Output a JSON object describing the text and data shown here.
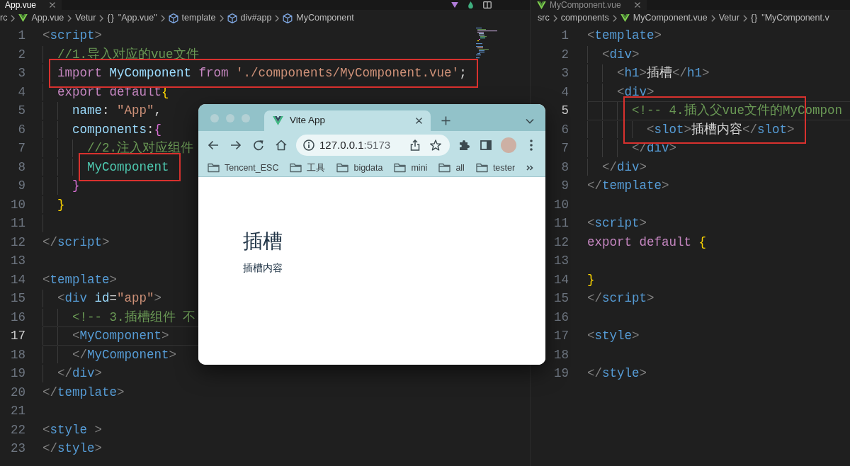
{
  "editor": {
    "panes": [
      {
        "focused": true,
        "toolbar_icons": true,
        "minimap": true,
        "tab": {
          "kind": "plain",
          "label": "App.vue"
        },
        "breadcrumbs": [
          {
            "kind": "text",
            "label": "rc"
          },
          {
            "kind": "vue",
            "label": "App.vue"
          },
          {
            "kind": "text",
            "label": "Vetur"
          },
          {
            "kind": "object",
            "symbol": "{}",
            "label": "\"App.vue\""
          },
          {
            "kind": "element",
            "label": "template"
          },
          {
            "kind": "element",
            "label": "div#app"
          },
          {
            "kind": "element",
            "label": "MyComponent"
          }
        ],
        "lines": [
          {
            "number": "1",
            "tokens": [
              {
                "kind": "punct",
                "text": "<"
              },
              {
                "kind": "tag",
                "text": "script"
              },
              {
                "kind": "punct",
                "text": ">"
              }
            ],
            "current": false,
            "framed": false,
            "children": [
              {
                "number": "2",
                "tokens": [
                  {
                    "kind": "comment",
                    "text": "//1.导入对应的vue文件"
                  }
                ],
                "current": false,
                "framed": false
              },
              {
                "number": "3",
                "tokens": [
                  {
                    "kind": "keyword",
                    "text": "import "
                  },
                  {
                    "kind": "name",
                    "text": "MyComponent "
                  },
                  {
                    "kind": "keyword",
                    "text": "from "
                  },
                  {
                    "kind": "string",
                    "text": "'./components/MyComponent.vue'"
                  },
                  {
                    "kind": "text",
                    "text": ";"
                  }
                ],
                "current": false,
                "framed": true
              },
              {
                "number": "4",
                "tokens": [
                  {
                    "kind": "keyword",
                    "text": "export default"
                  },
                  {
                    "kind": "brace",
                    "text": "{"
                  }
                ],
                "current": false,
                "framed": false,
                "children": [
                  {
                    "number": "5",
                    "tokens": [
                      {
                        "kind": "name",
                        "text": "name"
                      },
                      {
                        "kind": "text",
                        "text": ": "
                      },
                      {
                        "kind": "string",
                        "text": "\"App\""
                      },
                      {
                        "kind": "text",
                        "text": ","
                      }
                    ],
                    "current": false,
                    "framed": false
                  },
                  {
                    "number": "6",
                    "tokens": [
                      {
                        "kind": "name",
                        "text": "components"
                      },
                      {
                        "kind": "text",
                        "text": ":"
                      },
                      {
                        "kind": "brace2",
                        "text": "{"
                      }
                    ],
                    "current": false,
                    "framed": false,
                    "children": [
                      {
                        "number": "7",
                        "tokens": [
                          {
                            "kind": "comment",
                            "text": "//2.注入对应组件"
                          }
                        ],
                        "current": false,
                        "framed": false
                      },
                      {
                        "number": "8",
                        "tokens": [
                          {
                            "kind": "component",
                            "text": "MyComponent"
                          }
                        ],
                        "current": false,
                        "framed": true
                      }
                    ]
                  },
                  {
                    "number": "9",
                    "tokens": [
                      {
                        "kind": "brace2",
                        "text": "}"
                      }
                    ],
                    "current": false,
                    "framed": false
                  }
                ]
              },
              {
                "number": "10",
                "tokens": [
                  {
                    "kind": "brace",
                    "text": "}"
                  }
                ],
                "current": false,
                "framed": false
              },
              {
                "number": "11",
                "current": false,
                "framed": false
              }
            ]
          },
          {
            "number": "12",
            "tokens": [
              {
                "kind": "punct",
                "text": "</"
              },
              {
                "kind": "tag",
                "text": "script"
              },
              {
                "kind": "punct",
                "text": ">"
              }
            ],
            "current": false,
            "framed": false
          },
          {
            "number": "13",
            "current": false,
            "framed": false
          },
          {
            "number": "14",
            "tokens": [
              {
                "kind": "punct",
                "text": "<"
              },
              {
                "kind": "tag",
                "text": "template"
              },
              {
                "kind": "punct",
                "text": ">"
              }
            ],
            "current": false,
            "framed": false,
            "children": [
              {
                "number": "15",
                "tokens": [
                  {
                    "kind": "punct",
                    "text": "<"
                  },
                  {
                    "kind": "tag",
                    "text": "div "
                  },
                  {
                    "kind": "attr",
                    "text": "id"
                  },
                  {
                    "kind": "text",
                    "text": "="
                  },
                  {
                    "kind": "string",
                    "text": "\"app\""
                  },
                  {
                    "kind": "punct",
                    "text": ">"
                  }
                ],
                "current": false,
                "framed": false,
                "children": [
                  {
                    "number": "16",
                    "tokens": [
                      {
                        "kind": "comment",
                        "text": "<!-- 3.插槽组件 不"
                      }
                    ],
                    "current": false,
                    "framed": false
                  },
                  {
                    "number": "17",
                    "tokens": [
                      {
                        "kind": "punct",
                        "text": "<"
                      },
                      {
                        "kind": "tag",
                        "text": "MyComponent"
                      },
                      {
                        "kind": "punct",
                        "text": ">"
                      }
                    ],
                    "current": true,
                    "framed": false
                  },
                  {
                    "number": "18",
                    "tokens": [
                      {
                        "kind": "punct",
                        "text": "</"
                      },
                      {
                        "kind": "tag",
                        "text": "MyComponent"
                      },
                      {
                        "kind": "punct",
                        "text": ">"
                      }
                    ],
                    "current": false,
                    "framed": false
                  }
                ]
              },
              {
                "number": "19",
                "tokens": [
                  {
                    "kind": "punct",
                    "text": "</"
                  },
                  {
                    "kind": "tag",
                    "text": "div"
                  },
                  {
                    "kind": "punct",
                    "text": ">"
                  }
                ],
                "current": false,
                "framed": false
              }
            ]
          },
          {
            "number": "20",
            "tokens": [
              {
                "kind": "punct",
                "text": "</"
              },
              {
                "kind": "tag",
                "text": "template"
              },
              {
                "kind": "punct",
                "text": ">"
              }
            ],
            "current": false,
            "framed": false
          },
          {
            "number": "21",
            "current": false,
            "framed": false
          },
          {
            "number": "22",
            "tokens": [
              {
                "kind": "punct",
                "text": "<"
              },
              {
                "kind": "tag",
                "text": "style "
              },
              {
                "kind": "punct",
                "text": ">"
              }
            ],
            "current": false,
            "framed": false
          },
          {
            "number": "23",
            "tokens": [
              {
                "kind": "punct",
                "text": "</"
              },
              {
                "kind": "tag",
                "text": "style"
              },
              {
                "kind": "punct",
                "text": ">"
              }
            ],
            "current": false,
            "framed": false
          }
        ]
      },
      {
        "focused": false,
        "toolbar_icons": false,
        "minimap": false,
        "tab": {
          "kind": "vue",
          "label": "MyComponent.vue"
        },
        "breadcrumbs": [
          {
            "kind": "text",
            "label": "src"
          },
          {
            "kind": "text",
            "label": "components"
          },
          {
            "kind": "vue",
            "label": "MyComponent.vue"
          },
          {
            "kind": "text",
            "label": "Vetur"
          },
          {
            "kind": "object",
            "symbol": "{}",
            "label": "\"MyComponent.v"
          }
        ],
        "lines": [
          {
            "number": "1",
            "tokens": [
              {
                "kind": "punct",
                "text": "<"
              },
              {
                "kind": "tag",
                "text": "template"
              },
              {
                "kind": "punct",
                "text": ">"
              }
            ],
            "current": false,
            "framed": false,
            "children": [
              {
                "number": "2",
                "tokens": [
                  {
                    "kind": "punct",
                    "text": "<"
                  },
                  {
                    "kind": "tag",
                    "text": "div"
                  },
                  {
                    "kind": "punct",
                    "text": ">"
                  }
                ],
                "current": false,
                "framed": false,
                "children": [
                  {
                    "number": "3",
                    "tokens": [
                      {
                        "kind": "punct",
                        "text": "<"
                      },
                      {
                        "kind": "tag",
                        "text": "h1"
                      },
                      {
                        "kind": "punct",
                        "text": ">"
                      },
                      {
                        "kind": "text",
                        "text": "插槽"
                      },
                      {
                        "kind": "punct",
                        "text": "</"
                      },
                      {
                        "kind": "tag",
                        "text": "h1"
                      },
                      {
                        "kind": "punct",
                        "text": ">"
                      }
                    ],
                    "current": false,
                    "framed": false
                  },
                  {
                    "number": "4",
                    "tokens": [
                      {
                        "kind": "punct",
                        "text": "<"
                      },
                      {
                        "kind": "tag",
                        "text": "div"
                      },
                      {
                        "kind": "punct",
                        "text": ">"
                      }
                    ],
                    "current": false,
                    "framed": false,
                    "children": [
                      {
                        "number": "5",
                        "tokens": [
                          {
                            "kind": "comment",
                            "text": "<!-- 4.插入父vue文件的MyCompon"
                          }
                        ],
                        "current": true,
                        "framed": true,
                        "children": [
                          {
                            "number": "6",
                            "tokens": [
                              {
                                "kind": "punct",
                                "text": "<"
                              },
                              {
                                "kind": "tag",
                                "text": "slot"
                              },
                              {
                                "kind": "punct",
                                "text": ">"
                              },
                              {
                                "kind": "text",
                                "text": "插槽内容"
                              },
                              {
                                "kind": "punct",
                                "text": "</"
                              },
                              {
                                "kind": "tag",
                                "text": "slot"
                              },
                              {
                                "kind": "punct",
                                "text": ">"
                              }
                            ],
                            "current": false,
                            "framed": true
                          }
                        ]
                      },
                      {
                        "number": "7",
                        "tokens": [
                          {
                            "kind": "punct",
                            "text": "</"
                          },
                          {
                            "kind": "tag",
                            "text": "div"
                          },
                          {
                            "kind": "punct",
                            "text": ">"
                          }
                        ],
                        "current": false,
                        "framed": false
                      }
                    ]
                  }
                ]
              },
              {
                "number": "8",
                "tokens": [
                  {
                    "kind": "punct",
                    "text": "</"
                  },
                  {
                    "kind": "tag",
                    "text": "div"
                  },
                  {
                    "kind": "punct",
                    "text": ">"
                  }
                ],
                "current": false,
                "framed": false
              }
            ]
          },
          {
            "number": "9",
            "tokens": [
              {
                "kind": "punct",
                "text": "</"
              },
              {
                "kind": "tag",
                "text": "template"
              },
              {
                "kind": "punct",
                "text": ">"
              }
            ],
            "current": false,
            "framed": false
          },
          {
            "number": "10",
            "current": false,
            "framed": false
          },
          {
            "number": "11",
            "tokens": [
              {
                "kind": "punct",
                "text": "<"
              },
              {
                "kind": "tag",
                "text": "script"
              },
              {
                "kind": "punct",
                "text": ">"
              }
            ],
            "current": false,
            "framed": false
          },
          {
            "number": "12",
            "tokens": [
              {
                "kind": "keyword",
                "text": "export default "
              },
              {
                "kind": "brace",
                "text": "{"
              }
            ],
            "current": false,
            "framed": false
          },
          {
            "number": "13",
            "current": false,
            "framed": false
          },
          {
            "number": "14",
            "tokens": [
              {
                "kind": "brace",
                "text": "}"
              }
            ],
            "current": false,
            "framed": false
          },
          {
            "number": "15",
            "tokens": [
              {
                "kind": "punct",
                "text": "</"
              },
              {
                "kind": "tag",
                "text": "script"
              },
              {
                "kind": "punct",
                "text": ">"
              }
            ],
            "current": false,
            "framed": false
          },
          {
            "number": "16",
            "current": false,
            "framed": false
          },
          {
            "number": "17",
            "tokens": [
              {
                "kind": "punct",
                "text": "<"
              },
              {
                "kind": "tag",
                "text": "style"
              },
              {
                "kind": "punct",
                "text": ">"
              }
            ],
            "current": false,
            "framed": false
          },
          {
            "number": "18",
            "current": false,
            "framed": false
          },
          {
            "number": "19",
            "tokens": [
              {
                "kind": "punct",
                "text": "</"
              },
              {
                "kind": "tag",
                "text": "style"
              },
              {
                "kind": "punct",
                "text": ">"
              }
            ],
            "current": false,
            "framed": false
          }
        ]
      }
    ]
  },
  "browser": {
    "tab": {
      "title": "Vite App"
    },
    "url": {
      "host": "127.0.0.1",
      "port": ":5173"
    },
    "bookmarks": [
      "Tencent_ESC",
      "工具",
      "bigdata",
      "mini",
      "all",
      "tester"
    ],
    "page": {
      "heading": "插槽",
      "text": "插槽内容"
    }
  }
}
